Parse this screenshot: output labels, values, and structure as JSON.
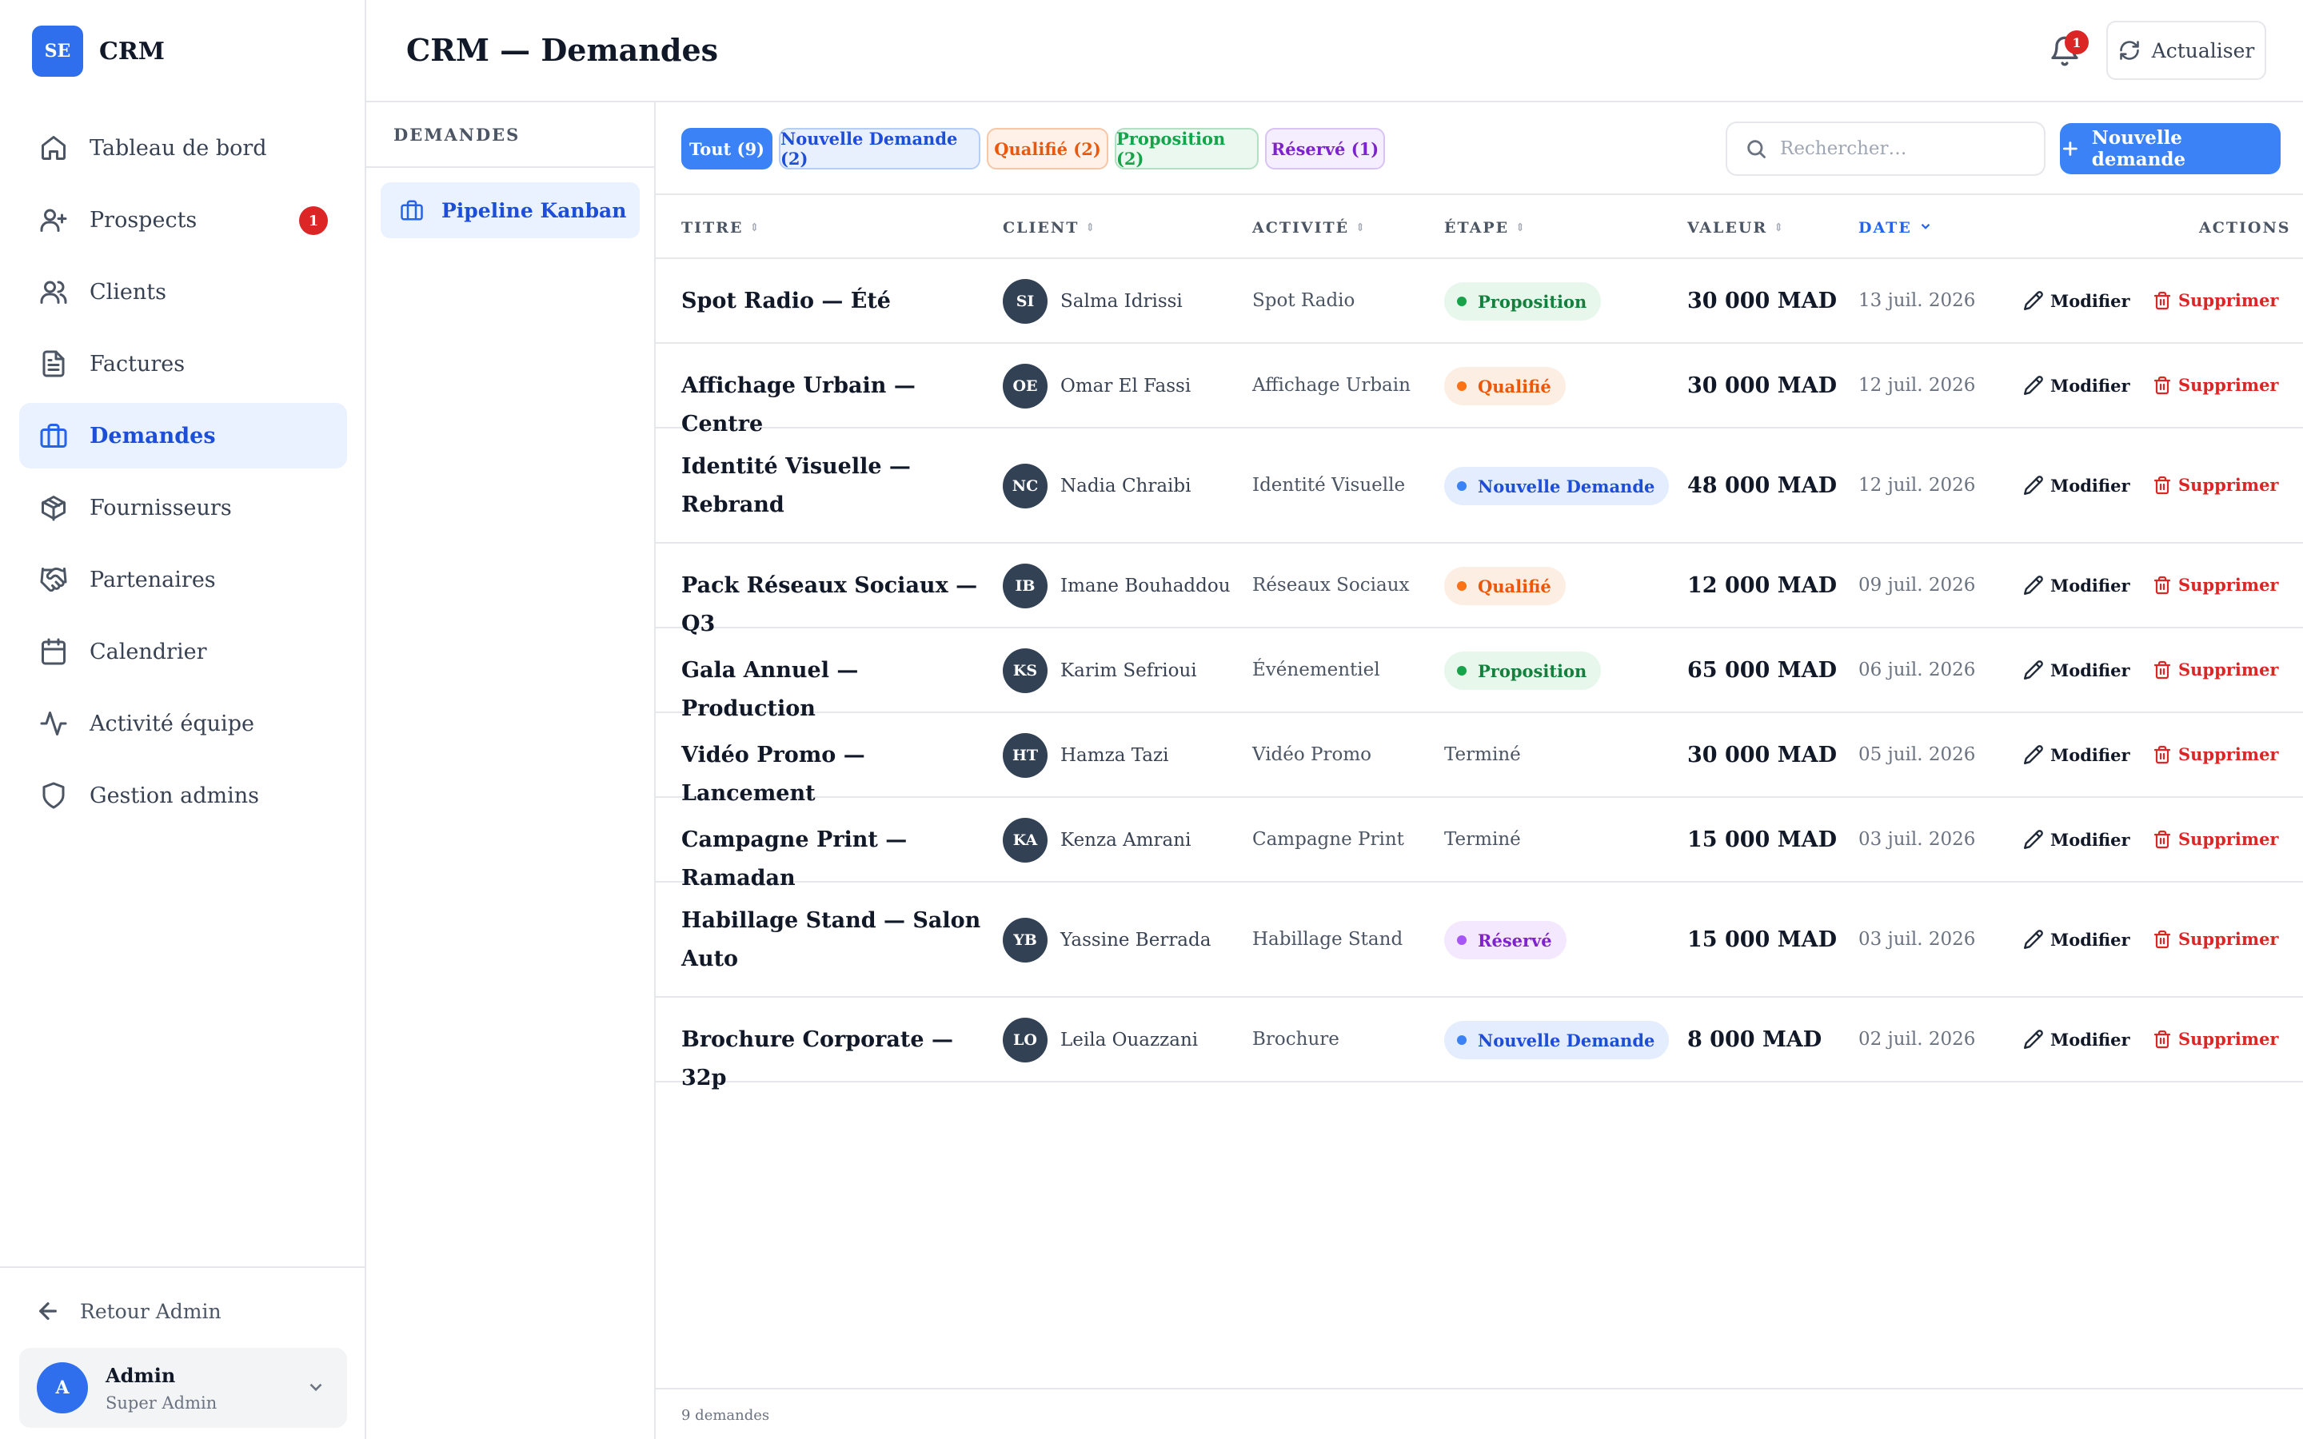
{
  "brand": {
    "logo_text": "SE",
    "name": "CRM",
    "accent": "#2f6fed"
  },
  "sidebar": {
    "items": [
      {
        "label": "Tableau de bord",
        "icon": "home-icon",
        "key": "dashboard"
      },
      {
        "label": "Prospects",
        "icon": "user-plus-icon",
        "key": "prospects",
        "badge": "1"
      },
      {
        "label": "Clients",
        "icon": "users-icon",
        "key": "clients"
      },
      {
        "label": "Factures",
        "icon": "file-text-icon",
        "key": "factures"
      },
      {
        "label": "Demandes",
        "icon": "briefcase-icon",
        "key": "demandes",
        "active": true
      },
      {
        "label": "Fournisseurs",
        "icon": "package-icon",
        "key": "fournisseurs"
      },
      {
        "label": "Partenaires",
        "icon": "handshake-icon",
        "key": "partenaires"
      },
      {
        "label": "Calendrier",
        "icon": "calendar-icon",
        "key": "calendrier"
      },
      {
        "label": "Activité équipe",
        "icon": "activity-icon",
        "key": "activite"
      },
      {
        "label": "Gestion admins",
        "icon": "shield-icon",
        "key": "admins"
      }
    ],
    "back_label": "Retour Admin",
    "user": {
      "initial": "A",
      "name": "Admin",
      "role": "Super Admin"
    }
  },
  "header": {
    "title": "CRM — Demandes",
    "notification_count": "1",
    "refresh_label": "Actualiser"
  },
  "subnav": {
    "heading": "DEMANDES",
    "item_label": "Pipeline Kanban"
  },
  "filters": {
    "all": "Tout (9)",
    "nouvelle": "Nouvelle Demande (2)",
    "qualifie": "Qualifié (2)",
    "proposition": "Proposition (2)",
    "reserve": "Réservé (1)"
  },
  "search": {
    "placeholder": "Rechercher…",
    "value": ""
  },
  "add_button": "Nouvelle demande",
  "table": {
    "columns": {
      "titre": "TITRE",
      "client": "CLIENT",
      "activite": "ACTIVITÉ",
      "etape": "ÉTAPE",
      "valeur": "VALEUR",
      "date": "DATE",
      "actions": "ACTIONS"
    },
    "sorted_by": "date",
    "edit_label": "Modifier",
    "delete_label": "Supprimer",
    "rows": [
      {
        "title": "Spot Radio — Été",
        "initials": "SI",
        "client": "Salma Idrissi",
        "activity": "Spot Radio",
        "stage": "Proposition",
        "stage_type": "proposition",
        "value": "30 000 MAD",
        "date": "13 juil. 2026"
      },
      {
        "title": "Affichage Urbain — Centre",
        "initials": "OE",
        "client": "Omar El Fassi",
        "activity": "Affichage Urbain",
        "stage": "Qualifié",
        "stage_type": "qualifie",
        "value": "30 000 MAD",
        "date": "12 juil. 2026"
      },
      {
        "title": "Identité Visuelle — Rebrand",
        "initials": "NC",
        "client": "Nadia Chraibi",
        "activity": "Identité Visuelle",
        "stage": "Nouvelle Demande",
        "stage_type": "nouvelle",
        "value": "48 000 MAD",
        "date": "12 juil. 2026"
      },
      {
        "title": "Pack Réseaux Sociaux — Q3",
        "initials": "IB",
        "client": "Imane Bouhaddou",
        "activity": "Réseaux Sociaux",
        "stage": "Qualifié",
        "stage_type": "qualifie",
        "value": "12 000 MAD",
        "date": "09 juil. 2026"
      },
      {
        "title": "Gala Annuel — Production",
        "initials": "KS",
        "client": "Karim Sefrioui",
        "activity": "Événementiel",
        "stage": "Proposition",
        "stage_type": "proposition",
        "value": "65 000 MAD",
        "date": "06 juil. 2026"
      },
      {
        "title": "Vidéo Promo — Lancement",
        "initials": "HT",
        "client": "Hamza Tazi",
        "activity": "Vidéo Promo",
        "stage": "Terminé",
        "stage_type": "plain",
        "value": "30 000 MAD",
        "date": "05 juil. 2026"
      },
      {
        "title": "Campagne Print — Ramadan",
        "initials": "KA",
        "client": "Kenza Amrani",
        "activity": "Campagne Print",
        "stage": "Terminé",
        "stage_type": "plain",
        "value": "15 000 MAD",
        "date": "03 juil. 2026"
      },
      {
        "title": "Habillage Stand — Salon Auto",
        "initials": "YB",
        "client": "Yassine Berrada",
        "activity": "Habillage Stand",
        "stage": "Réservé",
        "stage_type": "reserve",
        "value": "15 000 MAD",
        "date": "03 juil. 2026"
      },
      {
        "title": "Brochure Corporate — 32p",
        "initials": "LO",
        "client": "Leila Ouazzani",
        "activity": "Brochure",
        "stage": "Nouvelle Demande",
        "stage_type": "nouvelle",
        "value": "8 000 MAD",
        "date": "02 juil. 2026"
      }
    ]
  },
  "footer": {
    "count_label": "9 demandes"
  }
}
